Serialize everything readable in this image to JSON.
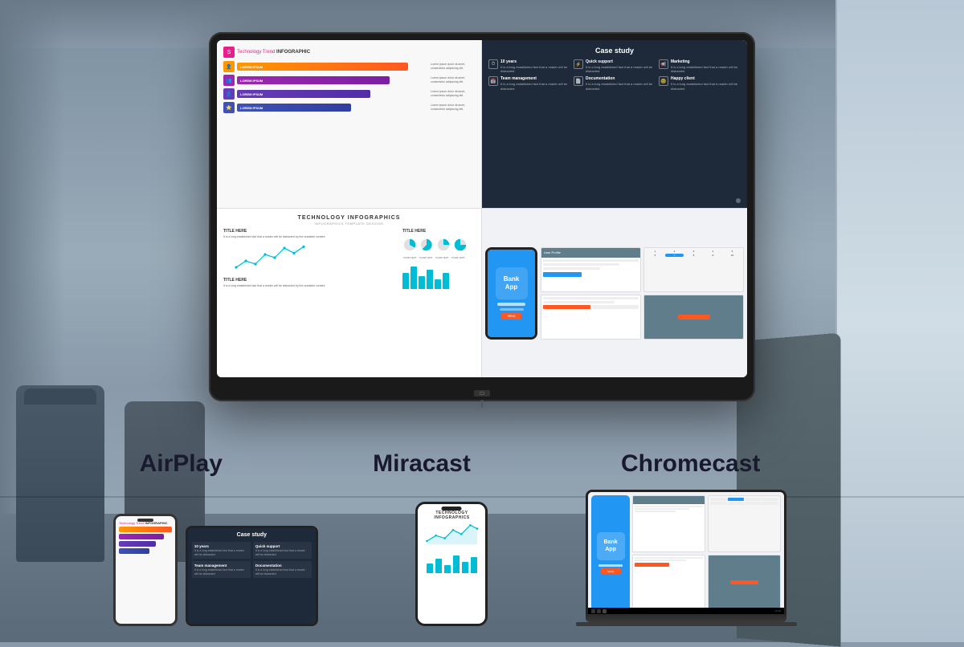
{
  "room": {
    "bg_color": "#8a9aaa"
  },
  "tv": {
    "screen_quadrants": {
      "q1": {
        "title_colored": "Technology Trend",
        "title_bold": "INFOGRAPHIC",
        "bars": [
          {
            "color": "#FF5722",
            "width": "80%",
            "label": "LOREM IPSUM",
            "desc": "Lorem ipsum dolor sit amet consectetur adipiscing"
          },
          {
            "color": "#9C27B0",
            "width": "70%",
            "label": "LOREM IPSUM",
            "desc": "Lorem ipsum dolor sit amet consectetur adipiscing"
          },
          {
            "color": "#673AB7",
            "width": "60%",
            "label": "LOREM IPSUM",
            "desc": "Lorem ipsum dolor sit amet consectetur adipiscing"
          },
          {
            "color": "#3F51B5",
            "width": "50%",
            "label": "LOREM IPSUM",
            "desc": "Lorem ipsum dolor sit amet consectetur adipiscing"
          }
        ]
      },
      "q2": {
        "title": "Case study",
        "items": [
          {
            "icon": "⏱",
            "title": "10 years",
            "text": "It is a long established fact that a reader will be distracted"
          },
          {
            "icon": "⚡",
            "title": "Quick support",
            "text": "It is a long established fact that a reader will be distracted"
          },
          {
            "icon": "📢",
            "title": "Marketing",
            "text": "It is a long established fact that a reader will be distracted"
          },
          {
            "icon": "📅",
            "title": "Team management",
            "text": "It is a long established fact that a reader will be distracted"
          },
          {
            "icon": "📄",
            "title": "Documentation",
            "text": "It is a long established fact that a reader will be distracted"
          },
          {
            "icon": "😊",
            "title": "Happy client",
            "text": "It is a long established fact that a reader will be distracted"
          }
        ]
      },
      "q3": {
        "title": "TECHNOLOGY INFOGRAPHICS",
        "subtitle": "INFOGRAPHICS TEMPLATE DESIGNS"
      },
      "q4": {
        "app_name": "Bank",
        "app_label": "App"
      }
    }
  },
  "protocols": {
    "airplay": {
      "label": "AirPlay"
    },
    "miracast": {
      "label": "Miracast"
    },
    "chromecast": {
      "label": "Chromecast"
    }
  },
  "devices": {
    "phone_infographic": "Technology Trend INFOGRAPHIC",
    "tablet_case_study": "Case study",
    "phone_tech": "TECHNOLOGY INFOGRAPHICS",
    "laptop_bank": "Bank App"
  }
}
